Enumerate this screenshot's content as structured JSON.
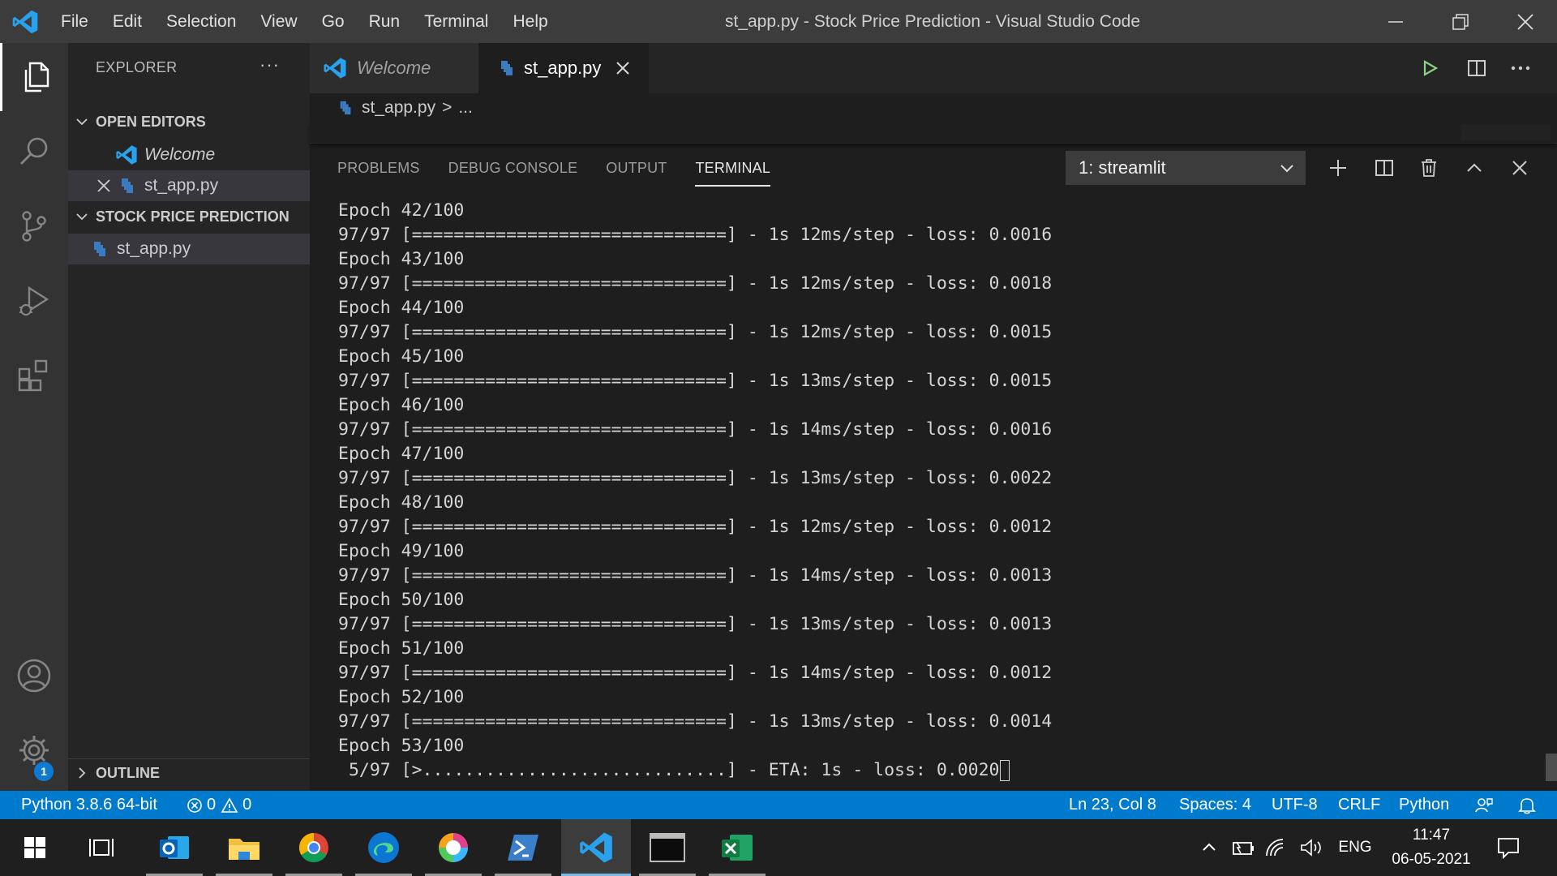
{
  "titlebar": {
    "menu": [
      "File",
      "Edit",
      "Selection",
      "View",
      "Go",
      "Run",
      "Terminal",
      "Help"
    ],
    "window_title": "st_app.py - Stock Price Prediction - Visual Studio Code"
  },
  "sidebar": {
    "title": "EXPLORER",
    "more": "···",
    "open_editors_label": "OPEN EDITORS",
    "open_editors": [
      {
        "label": "Welcome"
      },
      {
        "label": "st_app.py"
      }
    ],
    "project_label": "STOCK PRICE PREDICTION",
    "project_files": [
      {
        "label": "st_app.py"
      }
    ],
    "outline_label": "OUTLINE"
  },
  "activity": {
    "settings_badge": "1"
  },
  "tabs": [
    {
      "label": "Welcome"
    },
    {
      "label": "st_app.py"
    }
  ],
  "breadcrumb": {
    "file": "st_app.py",
    "sep": ">",
    "rest": "..."
  },
  "panel": {
    "tabs": [
      "PROBLEMS",
      "DEBUG CONSOLE",
      "OUTPUT",
      "TERMINAL"
    ],
    "active_tab": "TERMINAL",
    "terminal_select": "1: streamlit"
  },
  "terminal": {
    "lines": [
      "Epoch 42/100",
      "97/97 [==============================] - 1s 12ms/step - loss: 0.0016",
      "Epoch 43/100",
      "97/97 [==============================] - 1s 12ms/step - loss: 0.0018",
      "Epoch 44/100",
      "97/97 [==============================] - 1s 12ms/step - loss: 0.0015",
      "Epoch 45/100",
      "97/97 [==============================] - 1s 13ms/step - loss: 0.0015",
      "Epoch 46/100",
      "97/97 [==============================] - 1s 14ms/step - loss: 0.0016",
      "Epoch 47/100",
      "97/97 [==============================] - 1s 13ms/step - loss: 0.0022",
      "Epoch 48/100",
      "97/97 [==============================] - 1s 12ms/step - loss: 0.0012",
      "Epoch 49/100",
      "97/97 [==============================] - 1s 14ms/step - loss: 0.0013",
      "Epoch 50/100",
      "97/97 [==============================] - 1s 13ms/step - loss: 0.0013",
      "Epoch 51/100",
      "97/97 [==============================] - 1s 14ms/step - loss: 0.0012",
      "Epoch 52/100",
      "97/97 [==============================] - 1s 13ms/step - loss: 0.0014",
      "Epoch 53/100"
    ],
    "current_line": " 5/97 [>.............................] - ETA: 1s - loss: 0.0020"
  },
  "statusbar": {
    "interpreter": "Python 3.8.6 64-bit",
    "errors": "0",
    "warnings": "0",
    "position": "Ln 23, Col 8",
    "spaces": "Spaces: 4",
    "encoding": "UTF-8",
    "eol": "CRLF",
    "language": "Python"
  },
  "taskbar": {
    "time": "11:47",
    "date": "06-05-2021",
    "lang": "ENG"
  },
  "colors": {
    "accent": "#007acc",
    "titlebar": "#3c3c3c",
    "sidebar": "#252526",
    "editor": "#1e1e1e"
  }
}
